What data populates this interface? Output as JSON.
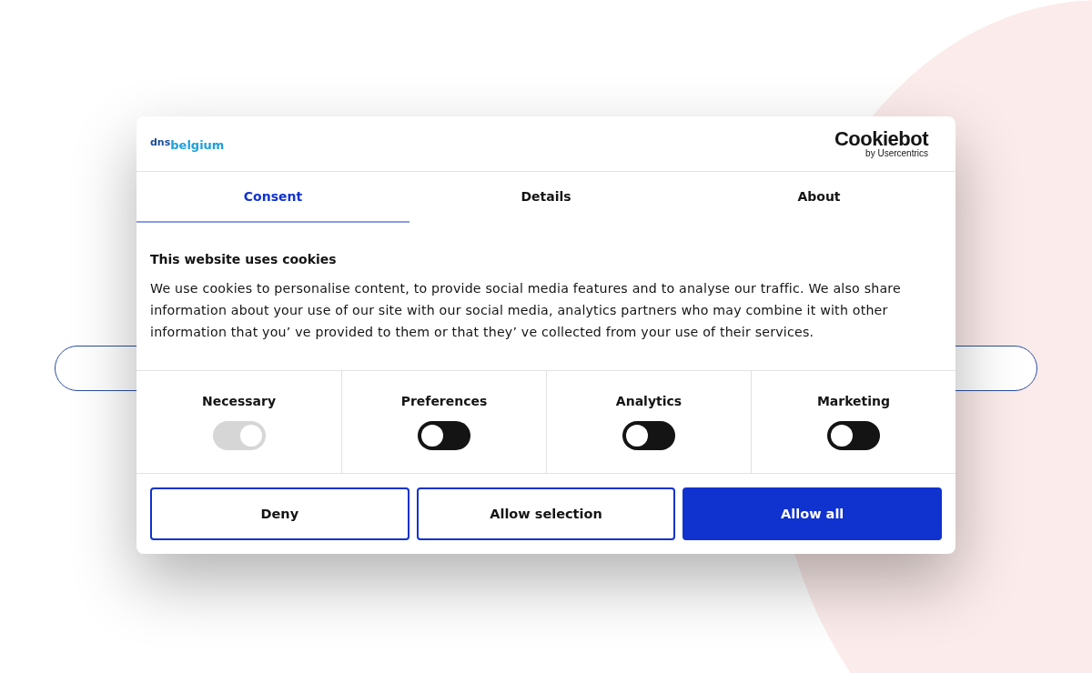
{
  "dialog": {
    "logo": {
      "primary": "dns",
      "secondary": "belgium"
    },
    "provider": {
      "name": "Cookiebot",
      "byline": "by Usercentrics"
    },
    "tabs": [
      {
        "label": "Consent",
        "selected": true
      },
      {
        "label": "Details",
        "selected": false
      },
      {
        "label": "About",
        "selected": false
      }
    ],
    "heading": "This website uses cookies",
    "body": "We use cookies to personalise content, to provide social media features and to analyse our traffic. We also share information about your use of our site with our social media, analytics partners who may combine it with other information that you’  ve provided to them or that they’  ve collected from your use of their services.",
    "categories": [
      {
        "label": "Necessary",
        "checked": true,
        "disabled": true
      },
      {
        "label": "Preferences",
        "checked": false,
        "disabled": false
      },
      {
        "label": "Analytics",
        "checked": false,
        "disabled": false
      },
      {
        "label": "Marketing",
        "checked": false,
        "disabled": false
      }
    ],
    "buttons": [
      {
        "label": "Deny",
        "kind": "outline"
      },
      {
        "label": "Allow selection",
        "kind": "outline"
      },
      {
        "label": "Allow all",
        "kind": "primary"
      }
    ]
  }
}
